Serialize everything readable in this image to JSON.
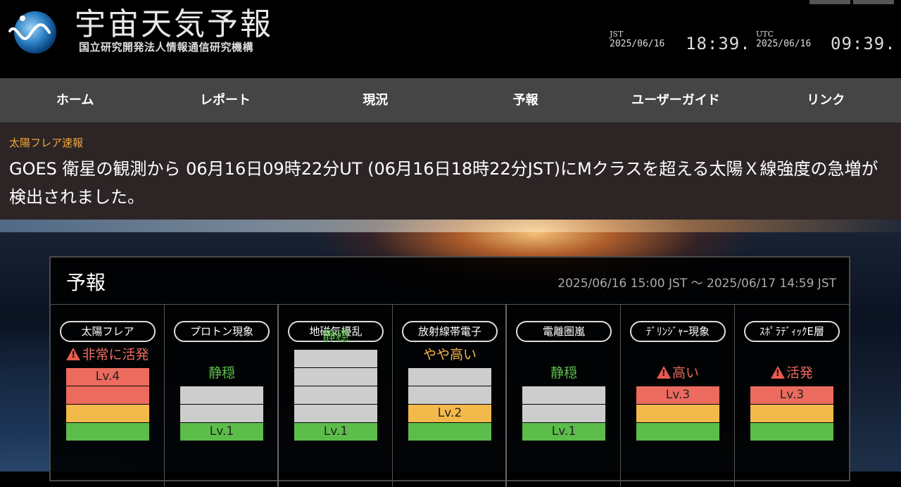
{
  "header": {
    "title": "宇宙天気予報",
    "org": "国立研究開発法人情報通信研究機構",
    "clock_jst": {
      "zone": "JST",
      "date": "2025/06/16",
      "time": "18:39."
    },
    "clock_utc": {
      "zone": "UTC",
      "date": "2025/06/16",
      "time": "09:39."
    }
  },
  "nav": [
    "ホーム",
    "レポート",
    "現況",
    "予報",
    "ユーザーガイド",
    "リンク"
  ],
  "alert": {
    "title": "太陽フレア速報",
    "text": "GOES 衛星の観測から 06月16日09時22分UT (06月16日18時22分JST)にMクラスを超える太陽Ｘ線強度の急増が検出されました。"
  },
  "forecast": {
    "title": "予報",
    "period": "2025/06/16 15:00 JST 〜 2025/06/17 14:59 JST",
    "items": [
      {
        "name": "太陽フレア",
        "status": "非常に活発",
        "warning": true,
        "status_color": "#ec6b5e",
        "level": 4,
        "level_label": "Lv.4",
        "max": 4
      },
      {
        "name": "プロトン現象",
        "status": "静穏",
        "warning": false,
        "status_color": "#5cbd4a",
        "level": 1,
        "level_label": "Lv.1",
        "max": 3
      },
      {
        "name": "地磁気擾乱",
        "status": "静穏",
        "warning": false,
        "status_color": "#5cbd4a",
        "level": 1,
        "level_label": "Lv.1",
        "max": 5
      },
      {
        "name": "放射線帯電子",
        "status": "やや高い",
        "warning": false,
        "status_color": "#f4b94b",
        "level": 2,
        "level_label": "Lv.2",
        "max": 4
      },
      {
        "name": "電離圏嵐",
        "status": "静穏",
        "warning": false,
        "status_color": "#5cbd4a",
        "level": 1,
        "level_label": "Lv.1",
        "max": 3
      },
      {
        "name": "ﾃﾞﾘﾝｼﾞｬｰ現象",
        "status": "高い",
        "warning": true,
        "status_color": "#ec6b5e",
        "level": 3,
        "level_label": "Lv.3",
        "max": 3
      },
      {
        "name": "ｽﾎﾟﾗﾃﾞｨｯｸE層",
        "status": "活発",
        "warning": true,
        "status_color": "#ec6b5e",
        "level": 3,
        "level_label": "Lv.3",
        "max": 3
      }
    ]
  }
}
